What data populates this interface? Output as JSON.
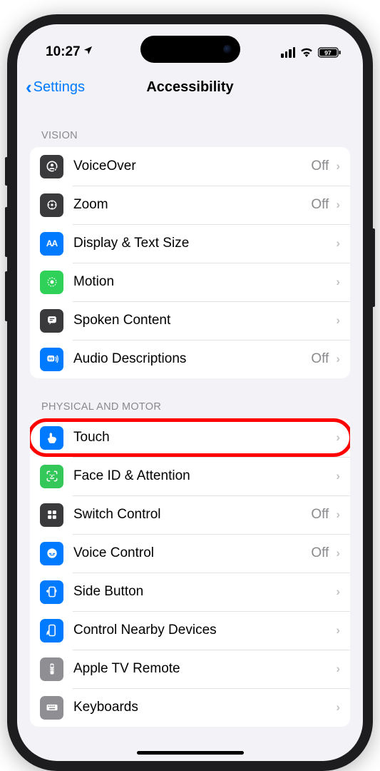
{
  "status": {
    "time": "10:27",
    "battery": "97"
  },
  "nav": {
    "back": "Settings",
    "title": "Accessibility"
  },
  "sections": {
    "vision_header": "VISION",
    "physical_header": "PHYSICAL AND MOTOR"
  },
  "rows": {
    "voiceover": {
      "label": "VoiceOver",
      "value": "Off"
    },
    "zoom": {
      "label": "Zoom",
      "value": "Off"
    },
    "display": {
      "label": "Display & Text Size",
      "value": ""
    },
    "motion": {
      "label": "Motion",
      "value": ""
    },
    "spoken": {
      "label": "Spoken Content",
      "value": ""
    },
    "audio": {
      "label": "Audio Descriptions",
      "value": "Off"
    },
    "touch": {
      "label": "Touch",
      "value": ""
    },
    "faceid": {
      "label": "Face ID & Attention",
      "value": ""
    },
    "switch": {
      "label": "Switch Control",
      "value": "Off"
    },
    "voicectrl": {
      "label": "Voice Control",
      "value": "Off"
    },
    "sidebtn": {
      "label": "Side Button",
      "value": ""
    },
    "nearby": {
      "label": "Control Nearby Devices",
      "value": ""
    },
    "appletv": {
      "label": "Apple TV Remote",
      "value": ""
    },
    "keyboards": {
      "label": "Keyboards",
      "value": ""
    }
  },
  "highlighted_row": "touch"
}
